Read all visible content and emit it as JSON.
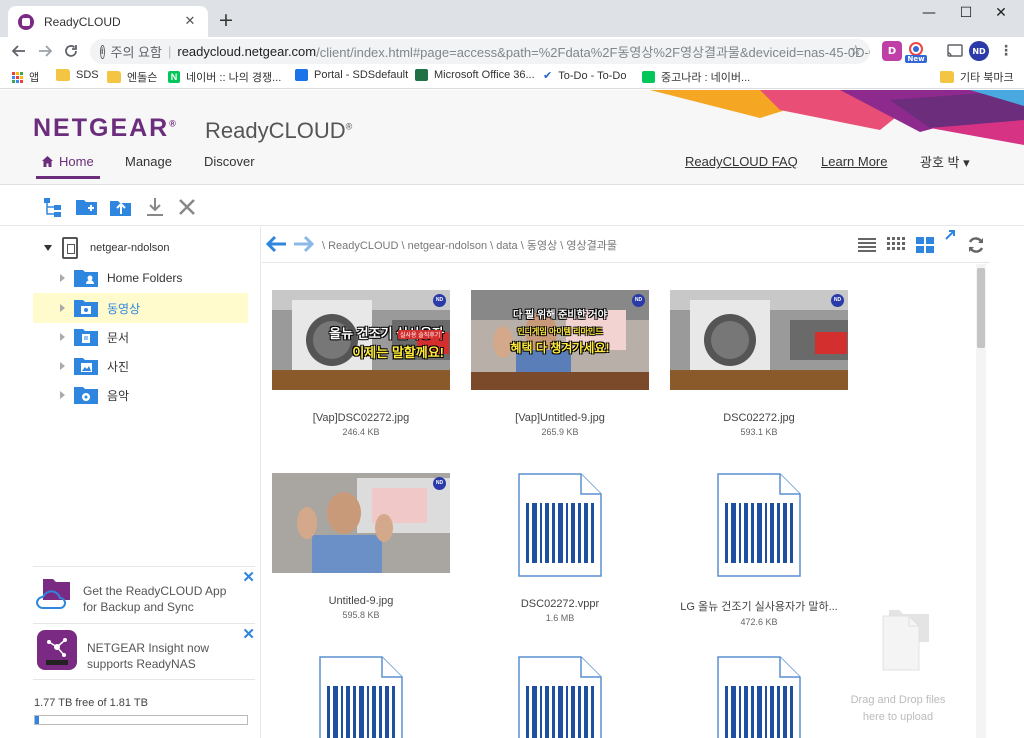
{
  "browser": {
    "tab_title": "ReadyCLOUD",
    "tab_close": "✕",
    "new_tab": "+",
    "window_controls": {
      "minimize": "—",
      "maximize": "☐",
      "close": "✕"
    },
    "address": {
      "info_icon": "i",
      "security_label": "주의 요함",
      "separator": "|",
      "host": "readycloud.netgear.com",
      "path": "/client/index.html#page=access&path=%2Fdata%2F동영상%2F영상결과물&deviceid=nas-45-0D-0E..."
    },
    "extensions": [
      {
        "label": "D",
        "color": "#c03fa7"
      },
      {
        "label": "New",
        "color": "#3367d6"
      },
      {
        "label": "ND",
        "color": "#2a3aa8"
      }
    ],
    "bookmarks": {
      "apps": "앱",
      "items": [
        {
          "label": "SDS",
          "icon": "folder-icon"
        },
        {
          "label": "엔돌슨",
          "icon": "folder-icon"
        },
        {
          "label": "네이버 :: 나의 경쟁...",
          "icon": "naver-icon"
        },
        {
          "label": "Portal - SDSdefault",
          "icon": "portal-icon"
        },
        {
          "label": "Microsoft Office 36...",
          "icon": "excel-icon"
        },
        {
          "label": "To-Do - To-Do",
          "icon": "todo-icon"
        },
        {
          "label": "중고나라 : 네이버...",
          "icon": "cafe-icon"
        }
      ],
      "other": "기타 북마크"
    }
  },
  "app": {
    "logo": "NETGEAR",
    "logo_mark": "®",
    "product": "ReadyCLOUD",
    "product_mark": "®",
    "nav": {
      "home": "Home",
      "manage": "Manage",
      "discover": "Discover"
    },
    "links": {
      "faq": "ReadyCLOUD FAQ",
      "learn": "Learn More"
    },
    "user": "광호 박 ▾",
    "colors": {
      "brand": "#6b2d7c",
      "accent": "#2e86de",
      "selected": "#fffbcc"
    }
  },
  "actions": [
    "tree-view-icon",
    "new-folder-icon",
    "upload-icon",
    "download-icon",
    "delete-icon"
  ],
  "sidebar": {
    "root": "netgear-ndolson",
    "items": [
      {
        "label": "Home Folders",
        "icon": "home-folder-icon",
        "selected": false
      },
      {
        "label": "동영상",
        "icon": "video-folder-icon",
        "selected": true
      },
      {
        "label": "문서",
        "icon": "document-folder-icon",
        "selected": false
      },
      {
        "label": "사진",
        "icon": "photo-folder-icon",
        "selected": false
      },
      {
        "label": "음악",
        "icon": "music-folder-icon",
        "selected": false
      }
    ],
    "promo_app": {
      "line1": "Get the ReadyCLOUD App",
      "line2": "for Backup and Sync",
      "close": "✕"
    },
    "promo_insight": {
      "line1": "NETGEAR Insight now",
      "line2": "supports ReadyNAS",
      "close": "✕"
    },
    "storage": {
      "text": "1.77 TB free of 1.81 TB",
      "used_fraction": 0.02
    }
  },
  "main": {
    "breadcrumb": "\\ ReadyCLOUD \\ netgear-ndolson \\ data \\ 동영상 \\ 영상결과물",
    "nd_badge": "ND",
    "files": [
      {
        "name": "[Vap]DSC02272.jpg",
        "size": "246.4 KB",
        "kind": "image",
        "caption_lines": [
          "올뉴 건조기 실사용자",
          "이제는 말할께요!"
        ],
        "tag": "실사용 솔직후기"
      },
      {
        "name": "[Vap]Untitled-9.jpg",
        "size": "265.9 KB",
        "kind": "image",
        "caption_lines": [
          "다 필 위해 준비한 거야",
          "인디게임 아이템 리마인드",
          "혜택 다 챙겨가세요!"
        ],
        "tag": ""
      },
      {
        "name": "DSC02272.jpg",
        "size": "593.1 KB",
        "kind": "image",
        "caption_lines": [],
        "tag": ""
      },
      {
        "name": "Untitled-9.jpg",
        "size": "595.8 KB",
        "kind": "image",
        "caption_lines": [],
        "tag": ""
      },
      {
        "name": "DSC02272.vppr",
        "size": "1.6 MB",
        "kind": "file",
        "caption_lines": [],
        "tag": ""
      },
      {
        "name": "LG 올뉴 건조기 실사용자가 말하...",
        "size": "472.6 KB",
        "kind": "file",
        "caption_lines": [],
        "tag": ""
      },
      {
        "name": "",
        "size": "",
        "kind": "file",
        "caption_lines": [],
        "tag": ""
      },
      {
        "name": "",
        "size": "",
        "kind": "file",
        "caption_lines": [],
        "tag": ""
      },
      {
        "name": "",
        "size": "",
        "kind": "file",
        "caption_lines": [],
        "tag": ""
      }
    ],
    "dropzone": {
      "line1": "Drag and Drop files",
      "line2": "here to upload"
    }
  }
}
